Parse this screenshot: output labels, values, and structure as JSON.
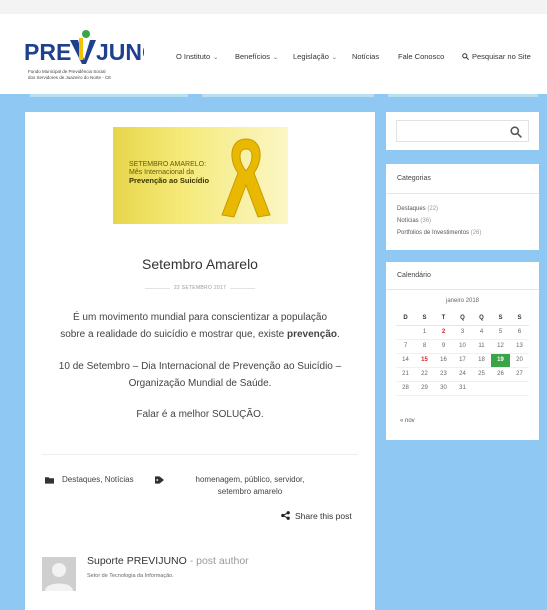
{
  "brand": {
    "logo_text": "PREVIJUNO",
    "subtitle_line1": "Fundo Municipal de Previdência Social",
    "subtitle_line2": "dos Servidores de Juazeiro do Norte - CE",
    "logo_blue": "#1f3f8f",
    "logo_yellow": "#f2c200",
    "logo_green": "#3aa548"
  },
  "nav": {
    "items": [
      {
        "label": "O Instituto",
        "dropdown": true
      },
      {
        "label": "Benefícios",
        "dropdown": true
      },
      {
        "label": "Legislação",
        "dropdown": true
      },
      {
        "label": "Notícias",
        "dropdown": false
      },
      {
        "label": "Fale Conosco",
        "dropdown": false
      }
    ],
    "search_label": "Pesquisar no Site"
  },
  "post": {
    "banner": {
      "line1": "SETEMBRO AMARELO:",
      "line2": "Mês Internacional da",
      "line3": "Prevenção ao Suicídio"
    },
    "title": "Setembro Amarelo",
    "date": "22 SETEMBRO 2017",
    "paragraph1_pre": "É um movimento mundial para conscientizar a população",
    "paragraph1_line2": "sobre a realidade do suicídio e mostrar que, existe",
    "paragraph1_bold": "prevenção",
    "paragraph1_end": ".",
    "paragraph2_line1": "10 de Setembro – Dia Internacional de Prevenção ao Suicídio –",
    "paragraph2_line2": "Organização Mundial de Saúde.",
    "paragraph3": "Falar é a melhor SOLUÇÃO.",
    "categories": "Destaques, Notícias",
    "tags_line1": "homenagem, público, servidor,",
    "tags_line2": "setembro amarelo",
    "share_label": "Share this post",
    "author_name": "Suporte PREVIJUNO",
    "author_role": " - post author",
    "author_desc": "Setor de Tecnologia da Informação."
  },
  "sidebar": {
    "search_placeholder": "",
    "categories_title": "Categorias",
    "categories": [
      {
        "name": "Destaques",
        "count": "(22)"
      },
      {
        "name": "Notícias",
        "count": "(36)"
      },
      {
        "name": "Portfolios de Investimentos",
        "count": "(26)"
      }
    ],
    "calendar_title": "Calendário",
    "calendar": {
      "month": "janeiro 2018",
      "weekdays": [
        "D",
        "S",
        "T",
        "Q",
        "Q",
        "S",
        "S"
      ],
      "weeks": [
        [
          "",
          "1",
          "2",
          "3",
          "4",
          "5",
          "6"
        ],
        [
          "7",
          "8",
          "9",
          "10",
          "11",
          "12",
          "13"
        ],
        [
          "14",
          "15",
          "16",
          "17",
          "18",
          "19",
          "20"
        ],
        [
          "21",
          "22",
          "23",
          "24",
          "25",
          "26",
          "27"
        ],
        [
          "28",
          "29",
          "30",
          "31",
          "",
          "",
          ""
        ]
      ],
      "highlight_red": [
        "2",
        "15"
      ],
      "today": "19",
      "prev_link": "« nov"
    }
  }
}
